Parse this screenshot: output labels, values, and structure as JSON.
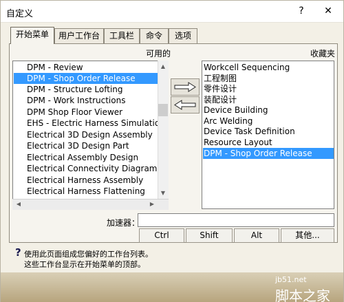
{
  "window": {
    "title": "自定义",
    "help": "?",
    "close": "✕"
  },
  "tabs": [
    {
      "label": "开始菜单",
      "active": true
    },
    {
      "label": "用户工作台",
      "active": false
    },
    {
      "label": "工具栏",
      "active": false
    },
    {
      "label": "命令",
      "active": false
    },
    {
      "label": "选项",
      "active": false
    }
  ],
  "available": {
    "label": "可用的",
    "items": [
      "DPM - Review",
      "DPM - Shop Order Release",
      "DPM - Structure Lofting",
      "DPM - Work Instructions",
      "DPM Shop Floor Viewer",
      "EHS - Electric Harness Simulation",
      "Electrical 3D Design Assembly",
      "Electrical 3D Design Part",
      "Electrical Assembly Design",
      "Electrical Connectivity Diagrams",
      "Electrical Harness Assembly",
      "Electrical Harness Flattening"
    ],
    "selected_index": 1
  },
  "favorites": {
    "label": "收藏夹",
    "items": [
      "Workcell Sequencing",
      "工程制图",
      "零件设计",
      "装配设计",
      "Device Building",
      "Arc Welding",
      "Device Task Definition",
      "Resource Layout",
      "DPM - Shop Order Release"
    ],
    "selected_index": 8
  },
  "accelerator": {
    "label": "加速器：",
    "value": ""
  },
  "modifier_buttons": {
    "ctrl": "Ctrl",
    "shift": "Shift",
    "alt": "Alt",
    "other": "其他..."
  },
  "info": {
    "line1": "使用此页面组成您偏好的工作台列表。",
    "line2": "这些工作台显示在开始菜单的顶部。"
  },
  "watermark": {
    "line1": "jb51.net",
    "line2": "脚本之家"
  },
  "colors": {
    "selection": "#3399ff",
    "dialog_bg": "#f3f0e6"
  }
}
